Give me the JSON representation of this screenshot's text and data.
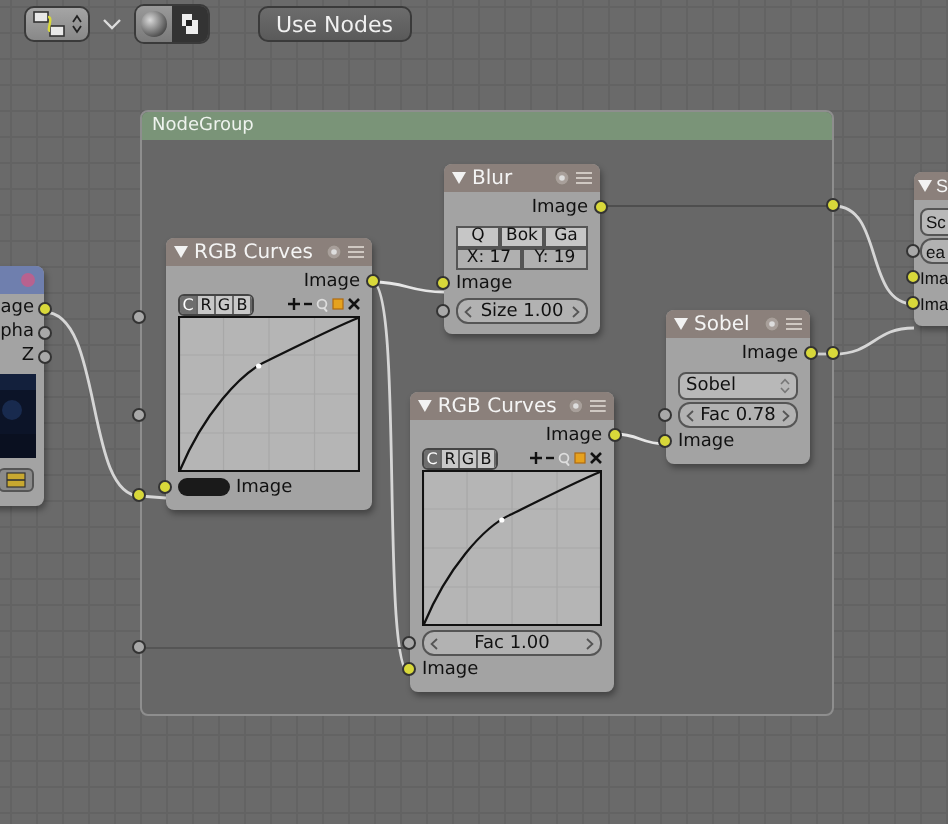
{
  "toolbar": {
    "button": "Use Nodes"
  },
  "frame": {
    "label": "NodeGroup",
    "left_sockets": [
      {
        "kind": "value"
      },
      {
        "kind": "value"
      },
      {
        "kind": "color"
      },
      {
        "kind": "value"
      }
    ],
    "right_sockets": [
      {
        "kind": "color"
      },
      {
        "kind": "color"
      }
    ]
  },
  "nodes": [
    {
      "rows": [
        {
          "kind": "output",
          "label": "age",
          "socket": {
            "kind": "color"
          }
        },
        {
          "kind": "output",
          "label": "pha",
          "socket": {
            "kind": "value"
          }
        },
        {
          "kind": "output",
          "label": "Z",
          "socket": {
            "kind": "value"
          }
        },
        {
          "kind": "preview"
        },
        {
          "kind": "icon-button"
        }
      ]
    },
    {
      "title": "RGB Curves",
      "rows": [
        {
          "kind": "output",
          "label": "Image",
          "socket": {
            "kind": "color"
          }
        },
        {
          "kind": "curve-buttons",
          "labels": [
            {
              "label": "C",
              "selected": true
            },
            {
              "label": "R",
              "selected": false
            },
            {
              "label": "G",
              "selected": false
            },
            {
              "label": "B",
              "selected": false
            }
          ]
        },
        {
          "kind": "curve"
        },
        {
          "kind": "color-input",
          "label": "Image",
          "socket": {
            "kind": "color"
          }
        }
      ]
    },
    {
      "title": "Blur",
      "rows": [
        {
          "kind": "output",
          "label": "Image",
          "socket": {
            "kind": "color"
          }
        },
        {
          "kind": "tabs",
          "labels": [
            "Q",
            "Bok",
            "Ga"
          ]
        },
        {
          "kind": "numbers",
          "labels": [
            "X: 17",
            "Y: 19"
          ]
        },
        {
          "kind": "input",
          "label": "Image",
          "socket": {
            "kind": "color"
          }
        },
        {
          "kind": "slider",
          "label": "Size 1.00",
          "socket": {
            "kind": "value"
          }
        }
      ]
    },
    {
      "title": "Sobel",
      "rows": [
        {
          "kind": "output",
          "label": "Image",
          "socket": {
            "kind": "color"
          }
        },
        {
          "kind": "dropdown",
          "label": "Sobel"
        },
        {
          "kind": "slider",
          "label": "Fac 0.78",
          "socket": {
            "kind": "value"
          }
        },
        {
          "kind": "input",
          "label": "Image",
          "socket": {
            "kind": "color"
          }
        }
      ]
    },
    {
      "title": "RGB Curves",
      "rows": [
        {
          "kind": "output",
          "label": "Image",
          "socket": {
            "kind": "color"
          }
        },
        {
          "kind": "curve-buttons",
          "labels": [
            {
              "label": "C",
              "selected": true
            },
            {
              "label": "R",
              "selected": false
            },
            {
              "label": "G",
              "selected": false
            },
            {
              "label": "B",
              "selected": false
            }
          ]
        },
        {
          "kind": "curve"
        },
        {
          "kind": "slider",
          "label": "Fac 1.00",
          "socket": {
            "kind": "value"
          }
        },
        {
          "kind": "input",
          "label": "Image",
          "socket": {
            "kind": "color"
          }
        }
      ]
    },
    {
      "title": "S",
      "rows": [
        {
          "kind": "dropdown",
          "label": "Sc"
        },
        {
          "kind": "slider",
          "label": "ea",
          "socket": {
            "kind": "value"
          }
        },
        {
          "kind": "input",
          "label": "Ima",
          "socket": {
            "kind": "color"
          }
        },
        {
          "kind": "input",
          "label": "Ima",
          "socket": {
            "kind": "color"
          }
        }
      ]
    }
  ]
}
